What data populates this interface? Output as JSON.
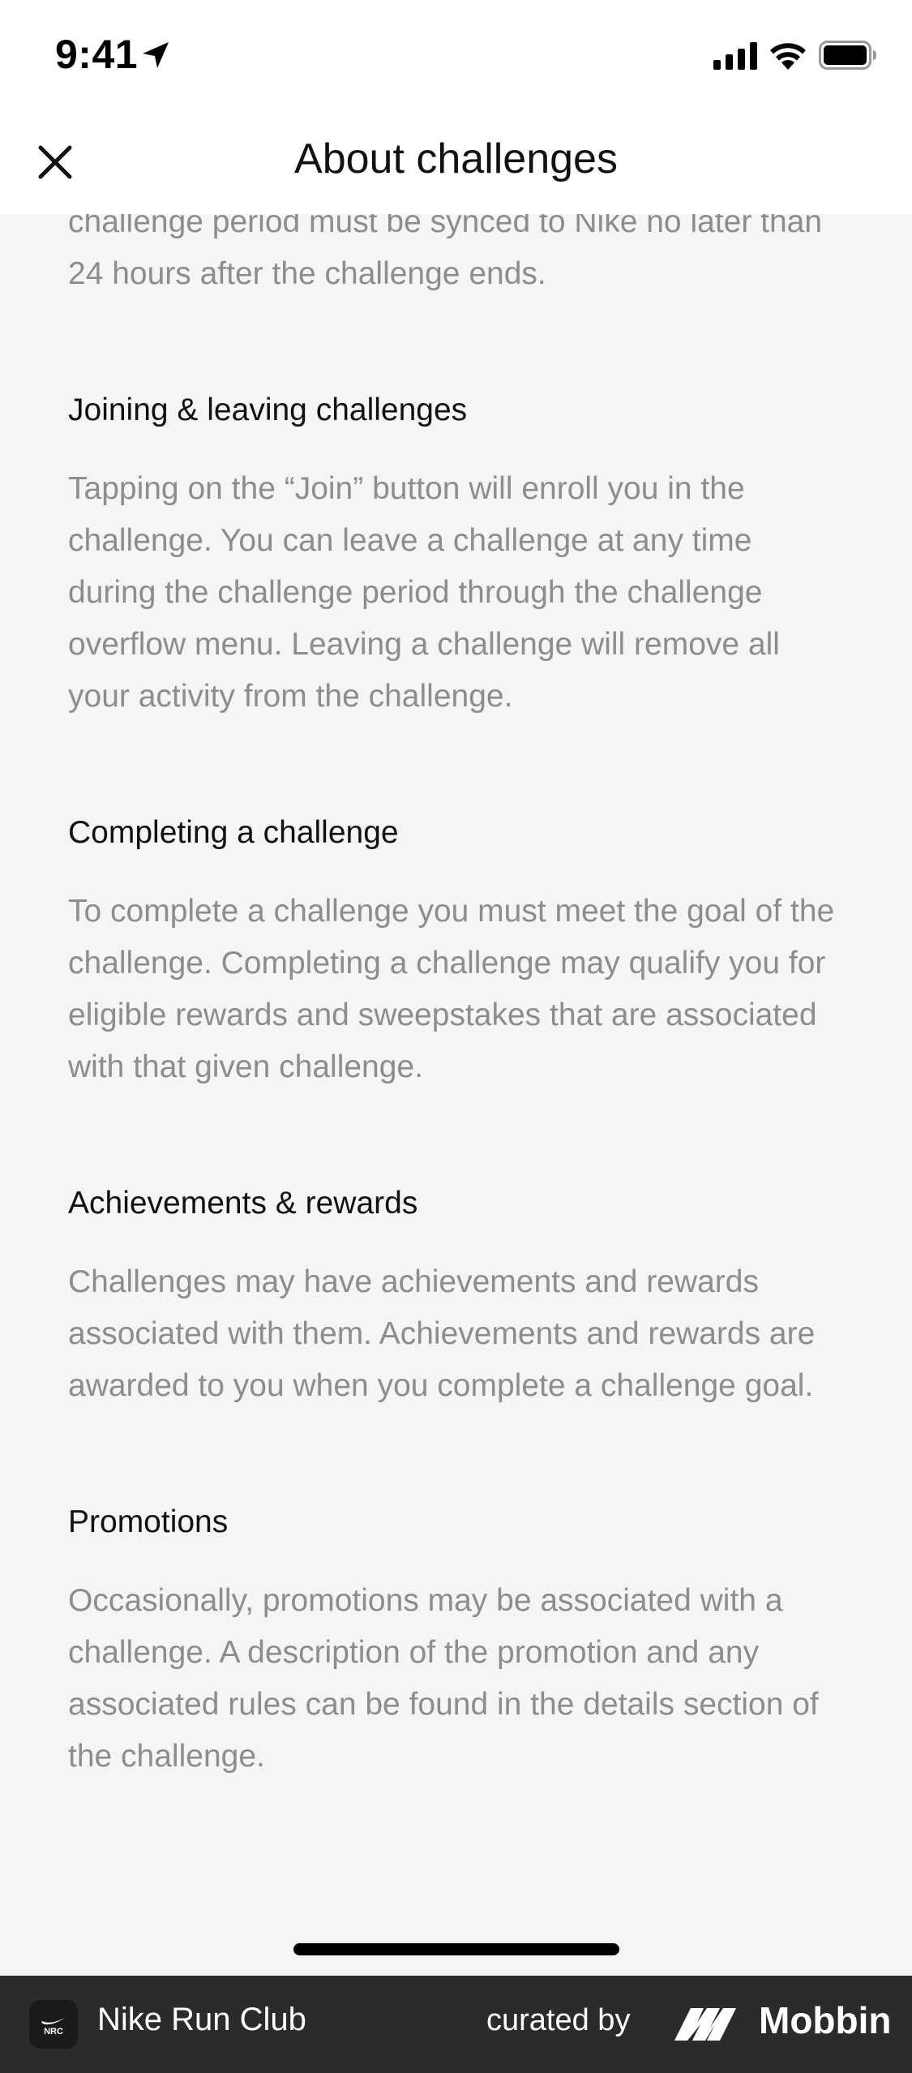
{
  "status": {
    "time": "9:41"
  },
  "nav": {
    "title": "About challenges"
  },
  "intro_text": "challenge period must be synced to Nike no later than 24 hours after the challenge ends.",
  "sections": [
    {
      "heading": "Joining & leaving challenges",
      "body": "Tapping on the “Join” button will enroll you in the challenge. You can leave a challenge at any time during the challenge period through the challenge overflow menu. Leaving a challenge will remove all your activity from the challenge."
    },
    {
      "heading": "Completing a challenge",
      "body": "To complete a challenge you must meet the goal of the challenge. Completing a challenge may qualify you for eligible rewards and sweepstakes that are associated with that given challenge."
    },
    {
      "heading": "Achievements & rewards",
      "body": "Challenges may have achievements and rewards associated with them. Achievements and rewards are awarded to you when you complete a challenge goal."
    },
    {
      "heading": "Promotions",
      "body": "Occasionally, promotions may be associated with a challenge. A description of the promotion and any associated rules can be found in the details section of the challenge."
    }
  ],
  "footer": {
    "app_name": "Nike Run Club",
    "app_icon_text": "NRC",
    "curated_label": "curated by",
    "brand": "Mobbin"
  },
  "colors": {
    "background": "#f5f5f5",
    "heading": "#111111",
    "body_text": "#8d8d8d",
    "footer_bg": "#2b2b2b"
  },
  "icons": {
    "location": "location-arrow-icon",
    "signal": "cellular-signal-icon",
    "wifi": "wifi-icon",
    "battery": "battery-icon",
    "close": "close-icon",
    "app": "nike-run-club-app-icon",
    "brand": "mobbin-logo-icon"
  }
}
